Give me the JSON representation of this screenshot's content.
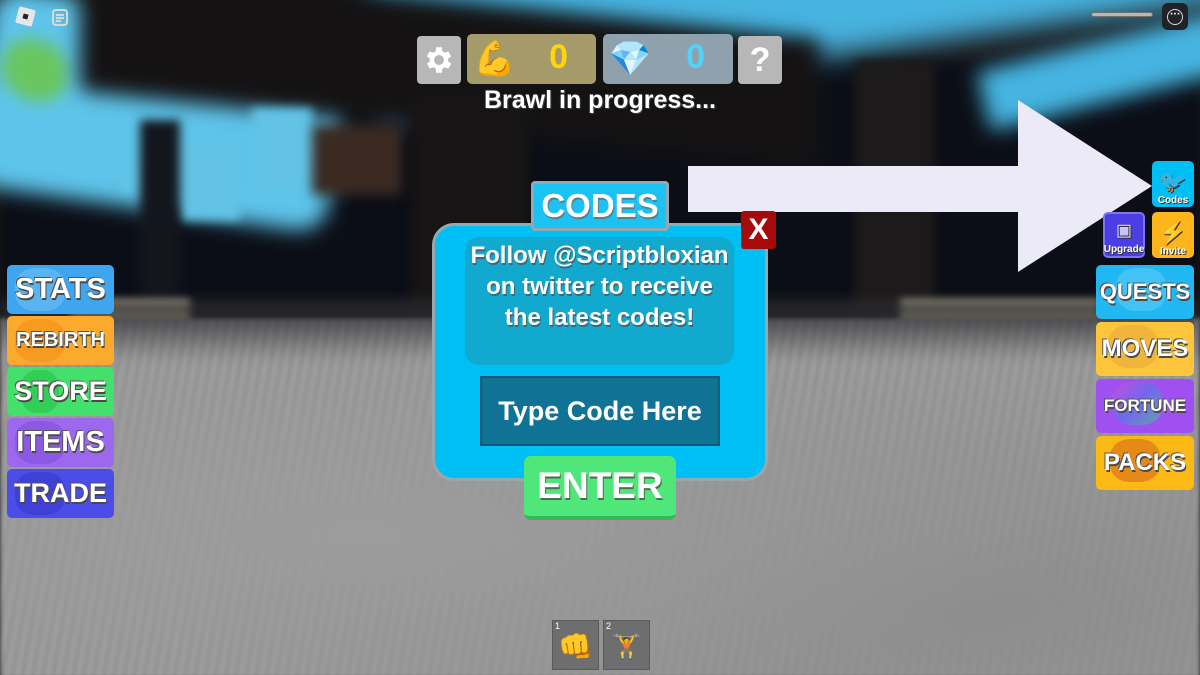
{
  "game": {
    "status_text": "Brawl in progress...",
    "hud": {
      "settings_icon": "gear-icon",
      "strength": {
        "icon": "flexed-biceps-icon",
        "value": "0",
        "color": "#ffd40e"
      },
      "gems": {
        "icon": "blue-gem-icon",
        "value": "0",
        "color": "#4fd3f7"
      },
      "help_label": "?"
    }
  },
  "codes_dialog": {
    "title": "CODES",
    "close_label": "X",
    "message": "Follow @Scriptbloxian on twitter to receive the latest codes!",
    "input": {
      "value": "",
      "placeholder": "Type Code Here"
    },
    "enter_label": "ENTER",
    "panel_color": "#00bff5"
  },
  "left_menu": [
    {
      "label": "STATS",
      "color": "#3ea6f0"
    },
    {
      "label": "REBIRTH",
      "color": "#fcaa2e"
    },
    {
      "label": "STORE",
      "color": "#44e06c"
    },
    {
      "label": "ITEMS",
      "color": "#9b68ee"
    },
    {
      "label": "TRADE",
      "color": "#4a4de8"
    }
  ],
  "right_menu": {
    "codes": {
      "label": "Codes",
      "icon": "twitter-bird-icon",
      "color": "#00bff5"
    },
    "upgrade": {
      "label": "Upgrade",
      "icon": "spiral-icon",
      "color": "#4b3fe3"
    },
    "invite": {
      "label": "Invite",
      "icon": "lightning-icon",
      "color": "#fdb51c"
    },
    "items": [
      {
        "label": "QUESTS",
        "color": "#20b7f2"
      },
      {
        "label": "MOVES",
        "color": "#fcc53c"
      },
      {
        "label": "FORTUNE",
        "color": "#a04ff0"
      },
      {
        "label": "PACKS",
        "color": "#fcb815"
      }
    ]
  },
  "hotbar": [
    {
      "slot": "1",
      "icon": "fist-icon"
    },
    {
      "slot": "2",
      "icon": "dumbbell-icon"
    }
  ],
  "annotation": {
    "type": "arrow",
    "points_to": "codes-button",
    "color": "#edeaf8"
  }
}
